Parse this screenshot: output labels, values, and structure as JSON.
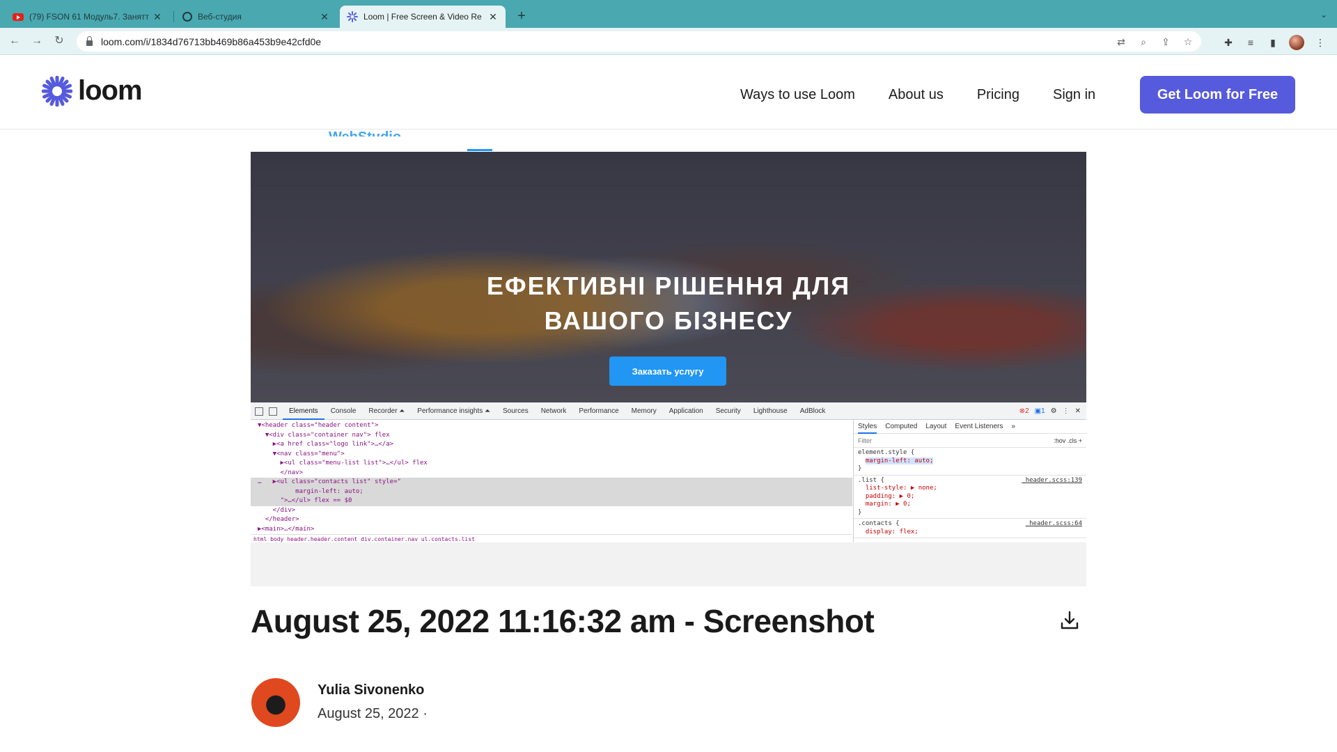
{
  "browser": {
    "tabs": [
      {
        "title": "(79) FSON 61 Модуль7. Занятт",
        "icon": "youtube-icon"
      },
      {
        "title": "Веб-студия",
        "icon": "globe-icon"
      },
      {
        "title": "Loom | Free Screen & Video Re",
        "icon": "loom-icon",
        "active": true
      }
    ],
    "new_tab": "+",
    "url": "loom.com/i/1834d76713bb469b86a453b9e42cfd0e"
  },
  "header": {
    "logo_text": "loom",
    "nav": [
      "Ways to use Loom",
      "About us",
      "Pricing",
      "Sign in"
    ],
    "cta": "Get Loom for Free"
  },
  "media": {
    "site_logo": "WebStudio",
    "hero_title_line1": "ЕФЕКТИВНІ РІШЕННЯ ДЛЯ",
    "hero_title_line2": "ВАШОГО БІЗНЕСУ",
    "hero_button": "Заказать услугу",
    "devtools": {
      "tabs": [
        "Elements",
        "Console",
        "Recorder ⏶",
        "Performance insights ⏶",
        "Sources",
        "Network",
        "Performance",
        "Memory",
        "Application",
        "Security",
        "Lighthouse",
        "AdBlock"
      ],
      "errors": "2",
      "messages": "1",
      "dom_lines": [
        "▼<header class=\"header content\">",
        "  ▼<div class=\"container nav\"> flex",
        "    ▶<a href class=\"logo link\">…</a>",
        "    ▼<nav class=\"menu\">",
        "      ▶<ul class=\"menu-list list\">…</ul> flex",
        "      </nav>",
        "…   ▶<ul class=\"contacts list\" style=\"",
        "          margin-left: auto;",
        "      \">…</ul> flex == $0",
        "    </div>",
        "  </header>",
        "▶<main>…</main>"
      ],
      "breadcrumbs": "html  body  header.header.content  div.container.nav  ul.contacts.list",
      "style_tabs": [
        "Styles",
        "Computed",
        "Layout",
        "Event Listeners",
        "»"
      ],
      "filter_placeholder": "Filter",
      "filter_tools": ":hov  .cls  +",
      "rules": [
        {
          "selector": "element.style {",
          "props": [
            "margin-left: auto;"
          ],
          "source": ""
        },
        {
          "selector": ".list {",
          "props": [
            "list-style: ▶ none;",
            "padding: ▶ 0;",
            "margin: ▶ 0;"
          ],
          "source": "_header.scss:139"
        },
        {
          "selector": ".contacts {",
          "props": [
            "display: flex;"
          ],
          "source": "_header.scss:64"
        }
      ]
    }
  },
  "video": {
    "title": "August 25, 2022 11:16:32 am - Screenshot",
    "author": "Yulia Sivonenko",
    "date": "August 25, 2022 ·"
  },
  "colors": {
    "accent": "#565add",
    "tabstrip": "#4aa8b0",
    "hero_button": "#2196f3"
  }
}
